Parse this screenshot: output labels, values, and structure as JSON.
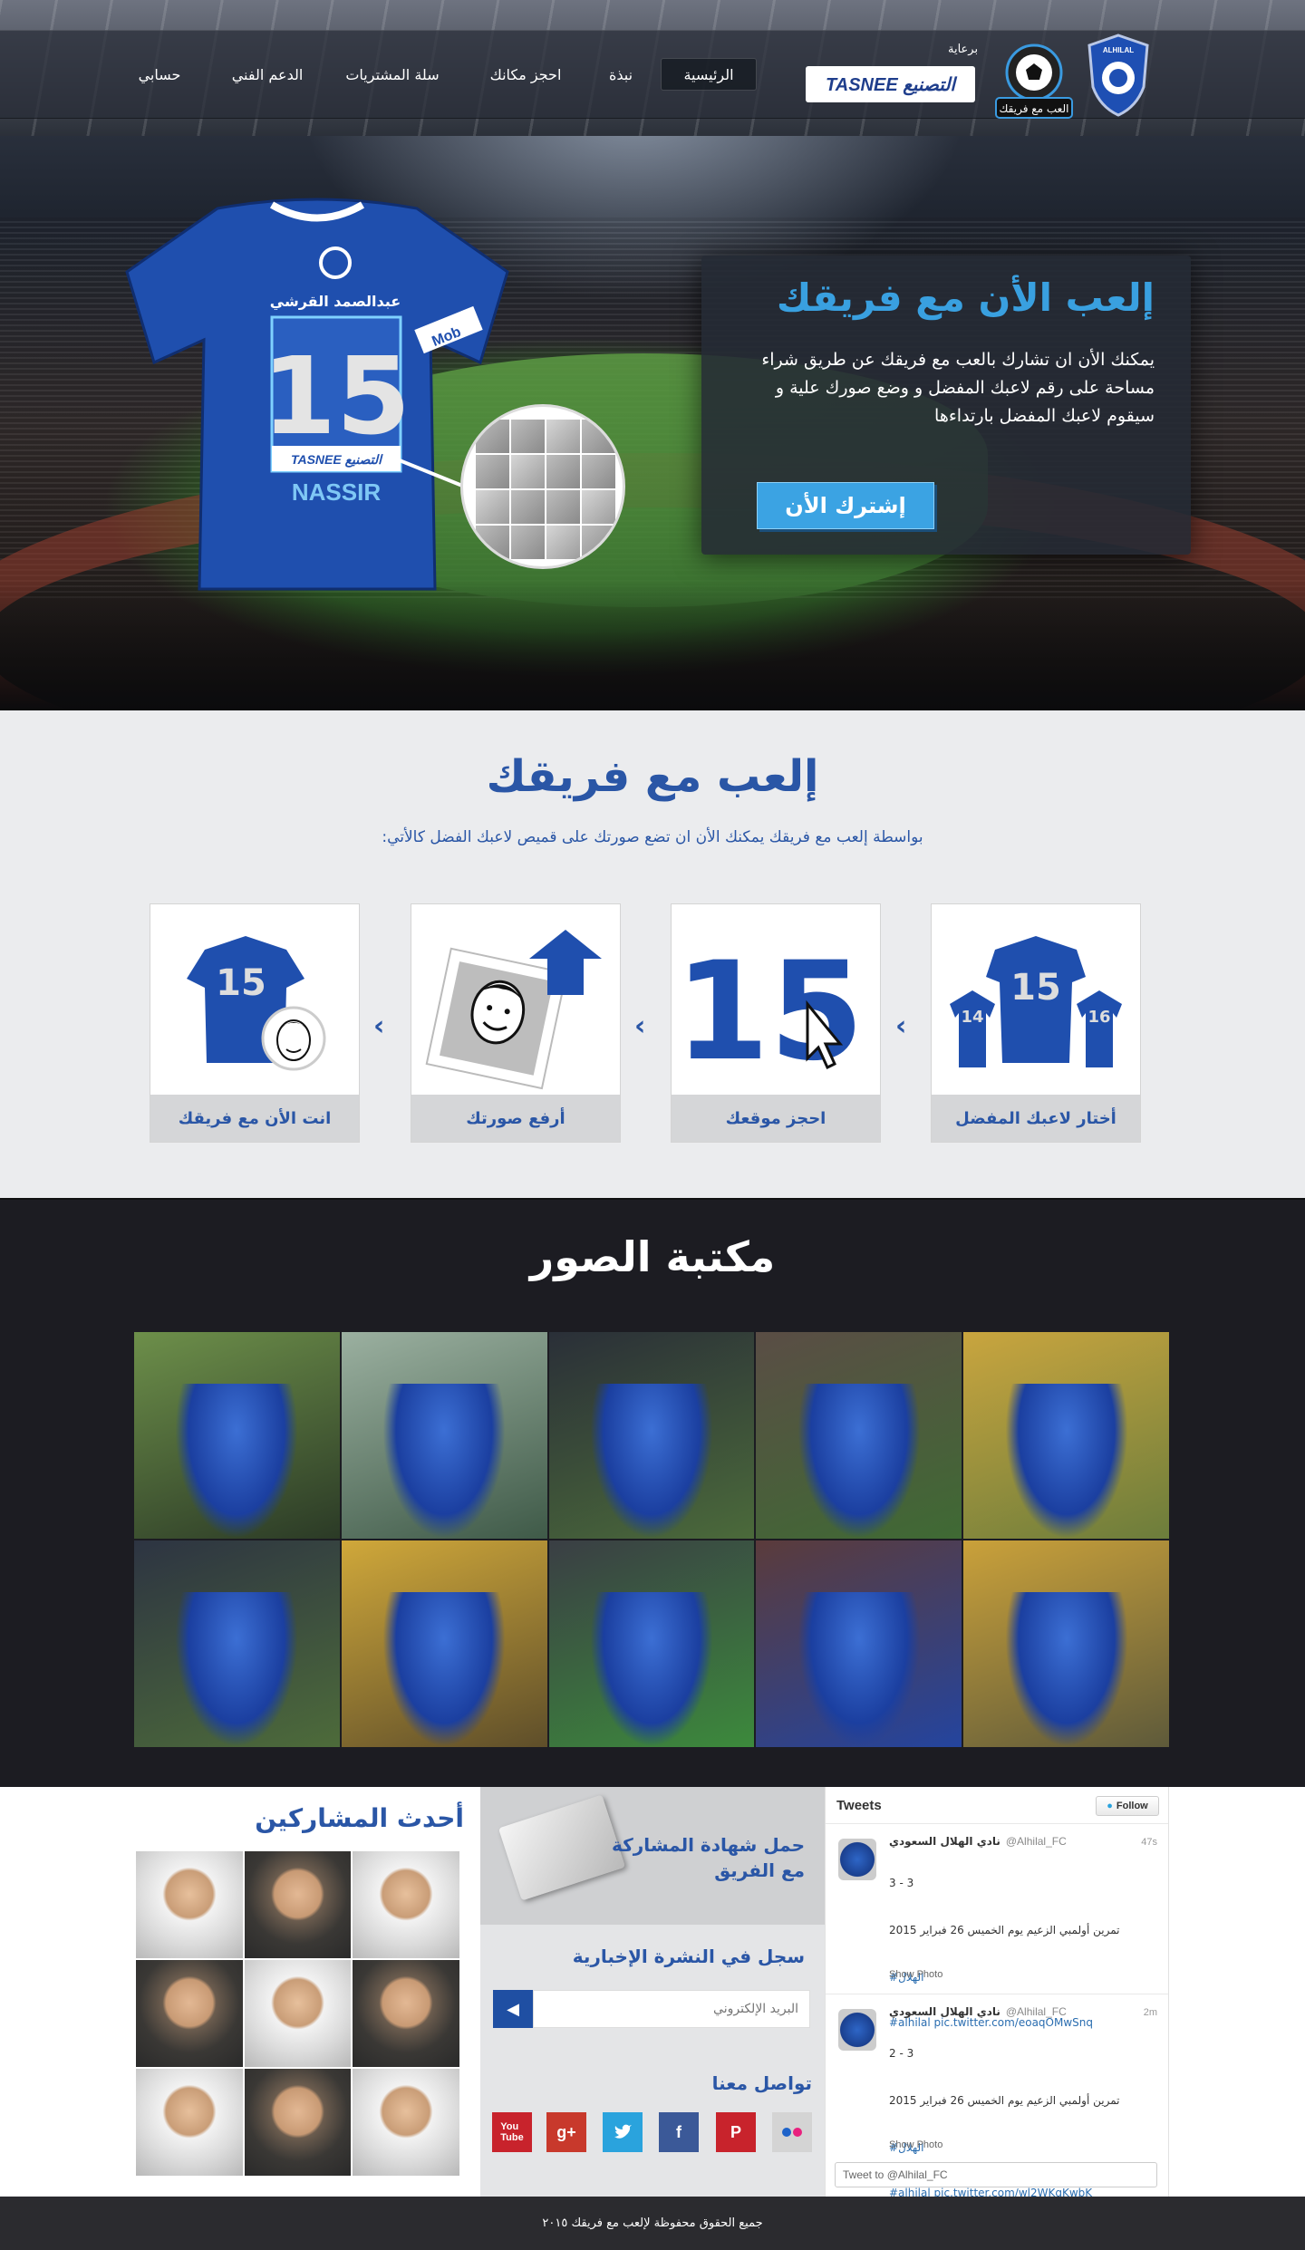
{
  "nav": {
    "items": [
      "الرئيسية",
      "نبذة",
      "احجز مكانك",
      "سلة المشتريات",
      "الدعم الفني",
      "حسابي"
    ],
    "sponsor_label": "برعاية",
    "sponsor_logo_text": "TASNEE التصنيع",
    "game_logo_text": "العب مع فريقك",
    "club_logo_text": "ALHILAL"
  },
  "hero": {
    "title": "إلعب الأن مع فريقك",
    "text": "يمكنك الأن ان تشارك بالعب مع فريقك عن طريق شراء مساحة على رقم لاعبك المفضل و وضع صورك علية و سيقوم لاعبك المفضل بارتداءها",
    "cta": "إشترك الأن",
    "jersey_name_ar": "عبدالصمد القرشي",
    "jersey_number": "15",
    "jersey_sponsor": "TASNEE التصنيع",
    "jersey_player": "NASSIR",
    "jersey_sleeve": "Mob"
  },
  "how": {
    "title": "إلعب مع فريقك",
    "subtitle": "بواسطة إلعب مع فريقك يمكنك الأن ان تضع صورتك على قميص لاعبك الفضل كالأتي:",
    "steps": [
      {
        "caption": "أختار لاعبك المفضل",
        "n_main": "15",
        "n_left": "14",
        "n_right": "16"
      },
      {
        "caption": "احجز موقعك",
        "n_main": "15"
      },
      {
        "caption": "أرفع صورتك"
      },
      {
        "caption": "انت الأن مع فريقك",
        "n_main": "15"
      }
    ]
  },
  "gallery": {
    "title": "مكتبة الصور"
  },
  "participants": {
    "title": "أحدث المشاركين"
  },
  "certificate": {
    "title": "حمل شهادة المشاركة مع الفريق"
  },
  "newsletter": {
    "title": "سجل في النشرة الإخبارية",
    "placeholder": "البريد الإلكتروني"
  },
  "contact": {
    "title": "تواصل معنا",
    "networks": [
      "flickr",
      "pinterest",
      "facebook",
      "twitter",
      "google-plus",
      "youtube"
    ]
  },
  "tweets": {
    "header": "Tweets",
    "follow": "Follow",
    "items": [
      {
        "name": "نادي الهلال السعودي",
        "handle": "@Alhilal_FC",
        "time": "47s",
        "score": "3 - 3",
        "text": "تمرين أولمبي الزعيم يوم الخميس 26 فبراير 2015",
        "tag": "#الهلال",
        "link": "#alhilal pic.twitter.com/eoaqOMwSnq",
        "photo": "Show Photo"
      },
      {
        "name": "نادي الهلال السعودي",
        "handle": "@Alhilal_FC",
        "time": "2m",
        "score": "2 - 3",
        "text": "تمرين أولمبي الزعيم يوم الخميس 26 فبراير 2015",
        "tag": "#الهلال",
        "link": "#alhilal pic.twitter.com/wl2WKqKwbK",
        "photo": "Show Photo"
      }
    ],
    "compose": "Tweet to @Alhilal_FC"
  },
  "footer": {
    "text": "جميع الحقوق محفوظة لإلعب مع فريقك ٢٠١٥"
  },
  "colors": {
    "brand_blue": "#2a56a6",
    "accent_blue": "#39a0e0",
    "dark": "#1c1c22"
  }
}
